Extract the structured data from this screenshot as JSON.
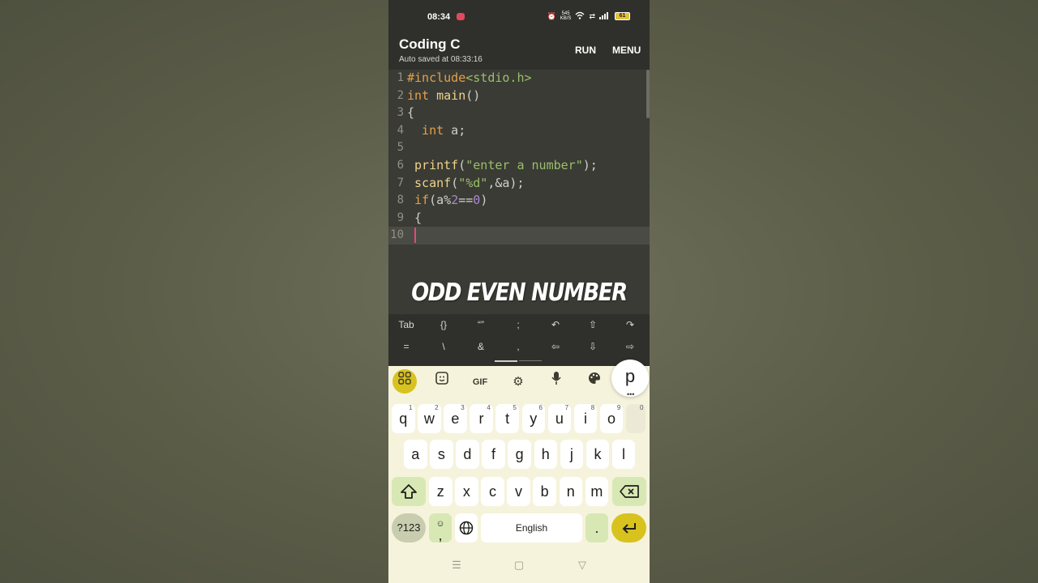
{
  "status_bar": {
    "time": "08:34",
    "speed": "545\nKB/S",
    "battery": "61"
  },
  "app_bar": {
    "title": "Coding C",
    "subtitle": "Auto saved at 08:33:16",
    "run_label": "RUN",
    "menu_label": "MENU"
  },
  "editor": {
    "line_numbers": [
      "1",
      "2",
      "3",
      "4",
      "5",
      "6",
      "7",
      "8",
      "9",
      "10"
    ],
    "lines": [
      [
        {
          "t": "#include",
          "c": "k"
        },
        {
          "t": "<stdio.h>",
          "c": "s"
        }
      ],
      [
        {
          "t": "int",
          "c": "k"
        },
        {
          "t": " ",
          "c": "p"
        },
        {
          "t": "main",
          "c": "f"
        },
        {
          "t": "()",
          "c": "p"
        }
      ],
      [
        {
          "t": "{",
          "c": "p"
        }
      ],
      [
        {
          "t": "  int",
          "c": "k"
        },
        {
          "t": " a;",
          "c": "p"
        }
      ],
      [],
      [
        {
          "t": " printf",
          "c": "f"
        },
        {
          "t": "(",
          "c": "p"
        },
        {
          "t": "\"enter a number\"",
          "c": "s"
        },
        {
          "t": ");",
          "c": "p"
        }
      ],
      [
        {
          "t": " scanf",
          "c": "f"
        },
        {
          "t": "(",
          "c": "p"
        },
        {
          "t": "\"%d\"",
          "c": "s"
        },
        {
          "t": ",&a);",
          "c": "p"
        }
      ],
      [
        {
          "t": " if",
          "c": "k"
        },
        {
          "t": "(a%",
          "c": "p"
        },
        {
          "t": "2",
          "c": "n"
        },
        {
          "t": "==",
          "c": "p"
        },
        {
          "t": "0",
          "c": "n"
        },
        {
          "t": ")",
          "c": "p"
        }
      ],
      [
        {
          "t": " {",
          "c": "p"
        }
      ],
      []
    ],
    "current_line": 9
  },
  "overlay_title": "ODD EVEN NUMBER",
  "symbol_bar": {
    "row1": [
      "Tab",
      "{}",
      "“”",
      ";",
      "↶",
      "⇧",
      "↷"
    ],
    "row2": [
      "=",
      "\\",
      "&",
      ",",
      "⇦",
      "⇩",
      "⇨"
    ]
  },
  "keyboard": {
    "toolbar": {
      "gif_label": "GIF",
      "suggestion": "p"
    },
    "row1": [
      {
        "k": "q",
        "h": "1"
      },
      {
        "k": "w",
        "h": "2"
      },
      {
        "k": "e",
        "h": "3"
      },
      {
        "k": "r",
        "h": "4"
      },
      {
        "k": "t",
        "h": "5"
      },
      {
        "k": "y",
        "h": "6"
      },
      {
        "k": "u",
        "h": "7"
      },
      {
        "k": "i",
        "h": "8"
      },
      {
        "k": "o",
        "h": "9"
      },
      {
        "k": "p",
        "h": "0"
      }
    ],
    "row2": [
      "a",
      "s",
      "d",
      "f",
      "g",
      "h",
      "j",
      "k",
      "l"
    ],
    "row3": [
      "z",
      "x",
      "c",
      "v",
      "b",
      "n",
      "m"
    ],
    "numeric_label": "?123",
    "comma_label": ",",
    "space_label": "English",
    "period_label": "."
  },
  "icons": {
    "shift": "shift-icon",
    "backspace": "backspace-icon",
    "enter": "enter-icon",
    "globe": "globe-icon"
  },
  "colors": {
    "accent": "#d8c21e",
    "caret": "#e24a7a",
    "keyword": "#e3a04c",
    "string": "#9bbf6a",
    "number": "#a989d0"
  }
}
